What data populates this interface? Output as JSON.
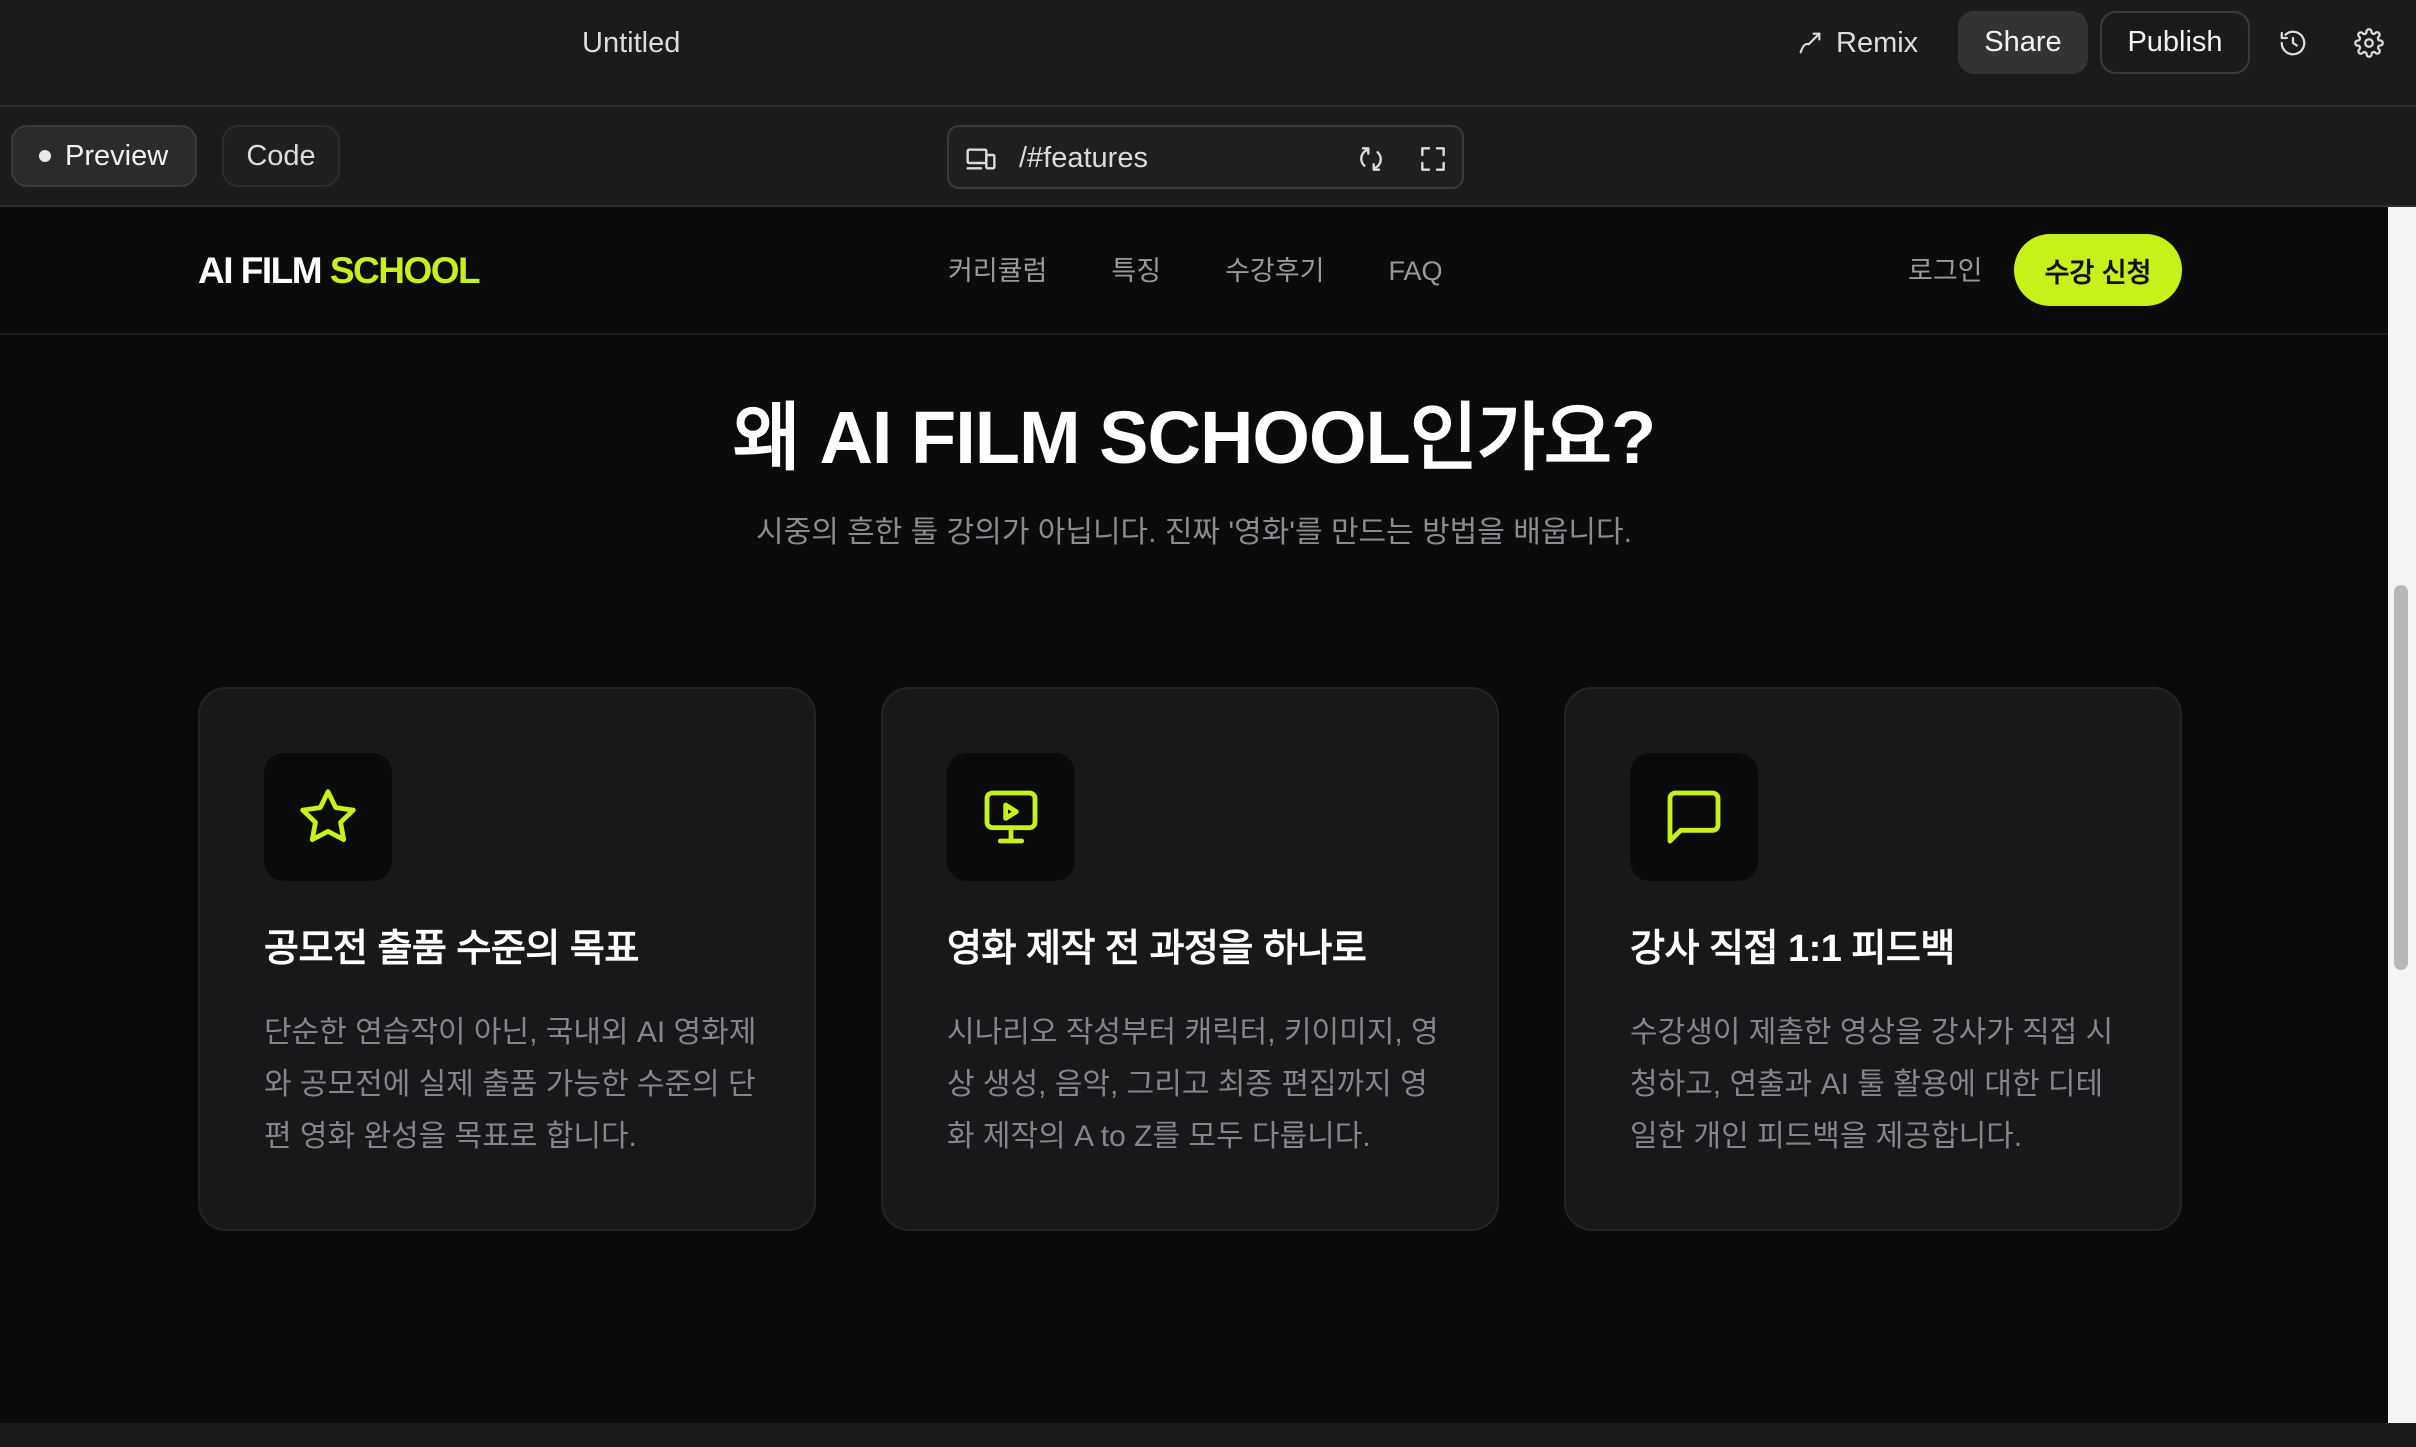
{
  "app": {
    "title": "Untitled",
    "remix_label": "Remix",
    "share_label": "Share",
    "publish_label": "Publish"
  },
  "toolbar": {
    "preview_label": "Preview",
    "code_label": "Code",
    "url": "/#features"
  },
  "site": {
    "logo_text": "AI FILM",
    "logo_accent": "SCHOOL",
    "nav": [
      "커리큘럼",
      "특징",
      "수강후기",
      "FAQ"
    ],
    "login_label": "로그인",
    "cta_label": "수강 신청",
    "headline": "왜 AI FILM SCHOOL인가요?",
    "subhead": "시중의 흔한 툴 강의가 아닙니다. 진짜 '영화'를 만드는 방법을 배웁니다.",
    "features": [
      {
        "icon": "star-icon",
        "title": "공모전 출품 수준의 목표",
        "text": "단순한 연습작이 아닌, 국내외 AI 영화제와 공모전에 실제 출품 가능한 수준의 단편 영화 완성을 목표로 합니다."
      },
      {
        "icon": "monitor-play-icon",
        "title": "영화 제작 전 과정을 하나로",
        "text": "시나리오 작성부터 캐릭터, 키이미지, 영상 생성, 음악, 그리고 최종 편집까지 영화 제작의 A to Z를 모두 다룹니다."
      },
      {
        "icon": "message-square-icon",
        "title": "강사 직접 1:1 피드백",
        "text": "수강생이 제출한 영상을 강사가 직접 시청하고, 연출과 AI 툴 활용에 대한 디테일한 개인 피드백을 제공합니다."
      }
    ]
  },
  "colors": {
    "accent": "#c6f21a",
    "page_bg": "#0b0b0c",
    "card_bg": "#18181a",
    "chrome_bg": "#1b1b1c"
  }
}
